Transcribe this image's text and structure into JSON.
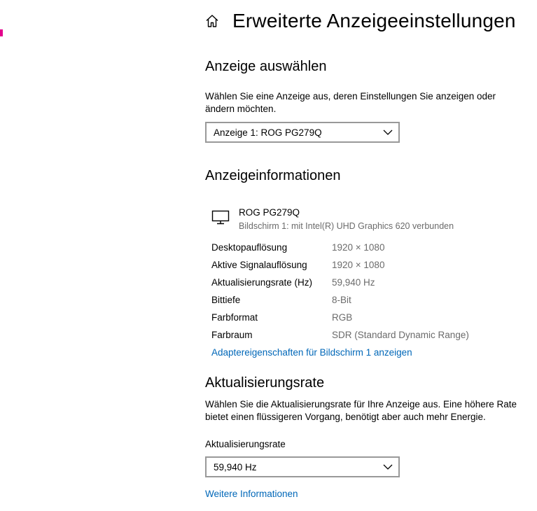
{
  "header": {
    "title": "Erweiterte Anzeigeeinstellungen",
    "home_icon": "home-icon"
  },
  "select_display": {
    "title": "Anzeige auswählen",
    "description": "Wählen Sie eine Anzeige aus, deren Einstellungen Sie anzeigen oder ändern möchten.",
    "dropdown_value": "Anzeige 1: ROG PG279Q"
  },
  "display_info": {
    "title": "Anzeigeinformationen",
    "monitor_name": "ROG PG279Q",
    "monitor_subtitle": "Bildschirm 1: mit Intel(R) UHD Graphics 620 verbunden",
    "rows": [
      {
        "label": "Desktopauflösung",
        "value": "1920 × 1080"
      },
      {
        "label": "Aktive Signalauflösung",
        "value": "1920 × 1080"
      },
      {
        "label": "Aktualisierungsrate (Hz)",
        "value": "59,940 Hz"
      },
      {
        "label": "Bittiefe",
        "value": "8-Bit"
      },
      {
        "label": "Farbformat",
        "value": "RGB"
      },
      {
        "label": "Farbraum",
        "value": "SDR (Standard Dynamic Range)"
      }
    ],
    "adapter_link": "Adaptereigenschaften für Bildschirm 1 anzeigen"
  },
  "refresh_rate": {
    "title": "Aktualisierungsrate",
    "description": "Wählen Sie die Aktualisierungsrate für Ihre Anzeige aus. Eine höhere Rate bietet einen flüssigeren Vorgang, benötigt aber auch mehr Energie.",
    "field_label": "Aktualisierungsrate",
    "dropdown_value": "59,940 Hz",
    "more_info_link": "Weitere Informationen"
  },
  "colors": {
    "accent": "#e3008c",
    "link": "#0067b8",
    "secondary_text": "#6b6b6b",
    "dropdown_border": "#999999"
  }
}
